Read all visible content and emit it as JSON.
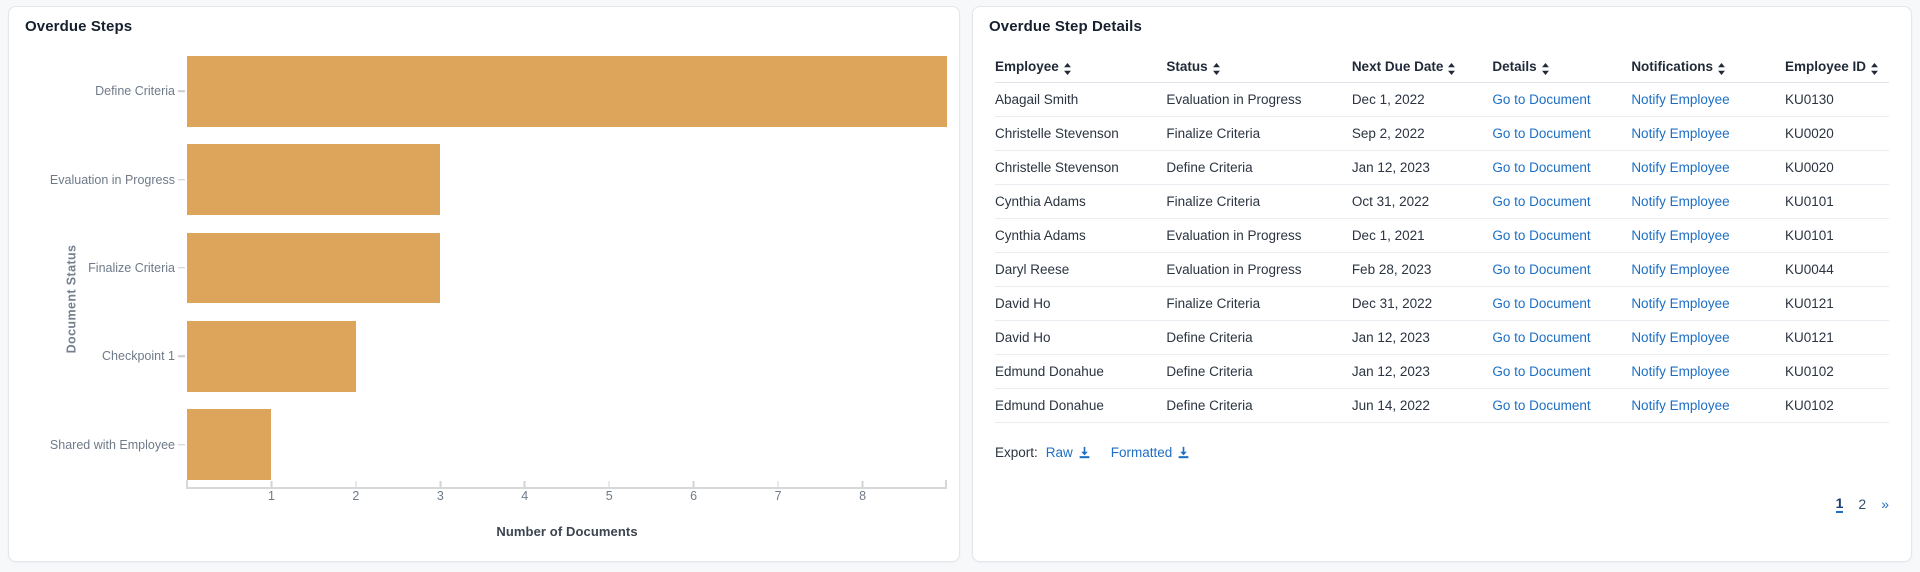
{
  "chart_panel": {
    "title": "Overdue Steps"
  },
  "chart_data": {
    "type": "bar",
    "orientation": "horizontal",
    "title": "Overdue Steps",
    "xlabel": "Number of Documents",
    "ylabel": "Document Status",
    "categories": [
      "Define Criteria",
      "Evaluation in Progress",
      "Finalize Criteria",
      "Checkpoint 1",
      "Shared with Employee"
    ],
    "values": [
      9,
      3,
      3,
      2,
      1
    ],
    "xticks": [
      1,
      2,
      3,
      4,
      5,
      6,
      7,
      8
    ],
    "xlim": [
      0,
      9
    ],
    "grid": false,
    "legend": false,
    "bar_color": "#dda45c"
  },
  "table_panel": {
    "title": "Overdue Step Details",
    "columns": [
      {
        "label": "Employee",
        "sortable": true
      },
      {
        "label": "Status",
        "sortable": true
      },
      {
        "label": "Next Due Date",
        "sortable": true
      },
      {
        "label": "Details",
        "sortable": true
      },
      {
        "label": "Notifications",
        "sortable": true
      },
      {
        "label": "Employee ID",
        "sortable": true
      }
    ],
    "rows": [
      {
        "employee": "Abagail Smith",
        "status": "Evaluation in Progress",
        "due": "Dec 1, 2022",
        "details": "Go to Document",
        "notify": "Notify Employee",
        "id": "KU0130"
      },
      {
        "employee": "Christelle Stevenson",
        "status": "Finalize Criteria",
        "due": "Sep 2, 2022",
        "details": "Go to Document",
        "notify": "Notify Employee",
        "id": "KU0020"
      },
      {
        "employee": "Christelle Stevenson",
        "status": "Define Criteria",
        "due": "Jan 12, 2023",
        "details": "Go to Document",
        "notify": "Notify Employee",
        "id": "KU0020"
      },
      {
        "employee": "Cynthia Adams",
        "status": "Finalize Criteria",
        "due": "Oct 31, 2022",
        "details": "Go to Document",
        "notify": "Notify Employee",
        "id": "KU0101"
      },
      {
        "employee": "Cynthia Adams",
        "status": "Evaluation in Progress",
        "due": "Dec 1, 2021",
        "details": "Go to Document",
        "notify": "Notify Employee",
        "id": "KU0101"
      },
      {
        "employee": "Daryl Reese",
        "status": "Evaluation in Progress",
        "due": "Feb 28, 2023",
        "details": "Go to Document",
        "notify": "Notify Employee",
        "id": "KU0044"
      },
      {
        "employee": "David Ho",
        "status": "Finalize Criteria",
        "due": "Dec 31, 2022",
        "details": "Go to Document",
        "notify": "Notify Employee",
        "id": "KU0121"
      },
      {
        "employee": "David Ho",
        "status": "Define Criteria",
        "due": "Jan 12, 2023",
        "details": "Go to Document",
        "notify": "Notify Employee",
        "id": "KU0121"
      },
      {
        "employee": "Edmund Donahue",
        "status": "Define Criteria",
        "due": "Jan 12, 2023",
        "details": "Go to Document",
        "notify": "Notify Employee",
        "id": "KU0102"
      },
      {
        "employee": "Edmund Donahue",
        "status": "Define Criteria",
        "due": "Jun 14, 2022",
        "details": "Go to Document",
        "notify": "Notify Employee",
        "id": "KU0102"
      }
    ],
    "export": {
      "label": "Export:",
      "raw": "Raw",
      "formatted": "Formatted",
      "icon": "download-icon"
    },
    "pagination": {
      "pages": [
        "1",
        "2"
      ],
      "active": "1",
      "next": "»"
    }
  },
  "icons": {
    "sort": "sort-arrows-icon",
    "download": "download-icon"
  },
  "colors": {
    "bar": "#dda45c",
    "link": "#1d6fc4",
    "card_border": "#e3e6ec",
    "page_bg": "#f7f8fa"
  }
}
